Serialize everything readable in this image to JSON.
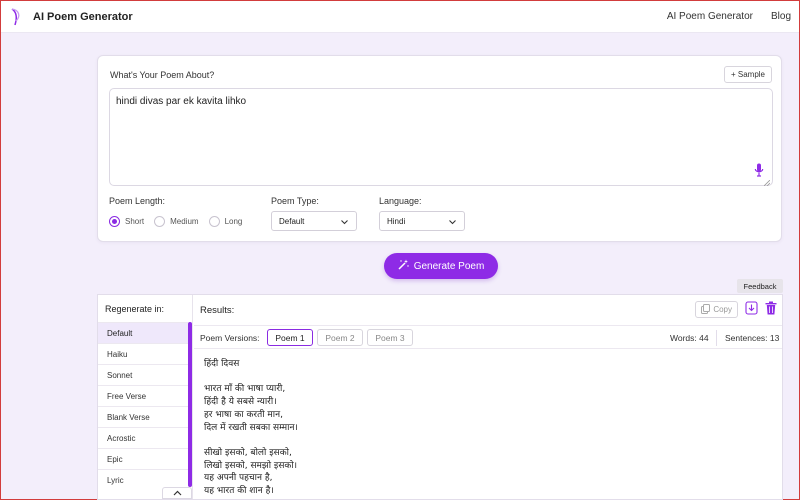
{
  "header": {
    "brand": "AI Poem Generator",
    "nav": [
      "AI Poem Generator",
      "Blog"
    ]
  },
  "prompt": {
    "title": "What's Your Poem About?",
    "sample_label": "+ Sample",
    "text": "hindi divas par ek kavita lihko"
  },
  "options": {
    "length_label": "Poem Length:",
    "lengths": [
      "Short",
      "Medium",
      "Long"
    ],
    "length_selected": "Short",
    "type_label": "Poem Type:",
    "type_value": "Default",
    "language_label": "Language:",
    "language_value": "Hindi"
  },
  "generate_label": "Generate Poem",
  "feedback_label": "Feedback",
  "results": {
    "regen_label": "Regenerate in:",
    "styles": [
      "Default",
      "Haiku",
      "Sonnet",
      "Free Verse",
      "Blank Verse",
      "Acrostic",
      "Epic",
      "Lyric"
    ],
    "active_style": "Default",
    "label": "Results:",
    "copy_label": "Copy",
    "versions_label": "Poem Versions:",
    "versions": [
      "Poem 1",
      "Poem 2",
      "Poem 3"
    ],
    "active_version": "Poem 1",
    "words": "Words: 44",
    "sentences": "Sentences: 13",
    "poem_title": "हिंदी दिवस",
    "stanza1": [
      "भारत माँ की भाषा प्यारी,",
      "हिंदी है ये सबसे न्यारी।",
      "हर भाषा का करती मान,",
      "दिल में रखती सबका सम्मान।"
    ],
    "stanza2": [
      "सीखो इसको, बोलो इसको,",
      "लिखो इसको, समझो इसको।",
      "यह अपनी पहचान है,",
      "यह भारत की शान है।"
    ]
  },
  "colors": {
    "accent": "#8e2be6",
    "page_bg": "#f3eefb",
    "active_item_bg": "#efe8fb"
  }
}
